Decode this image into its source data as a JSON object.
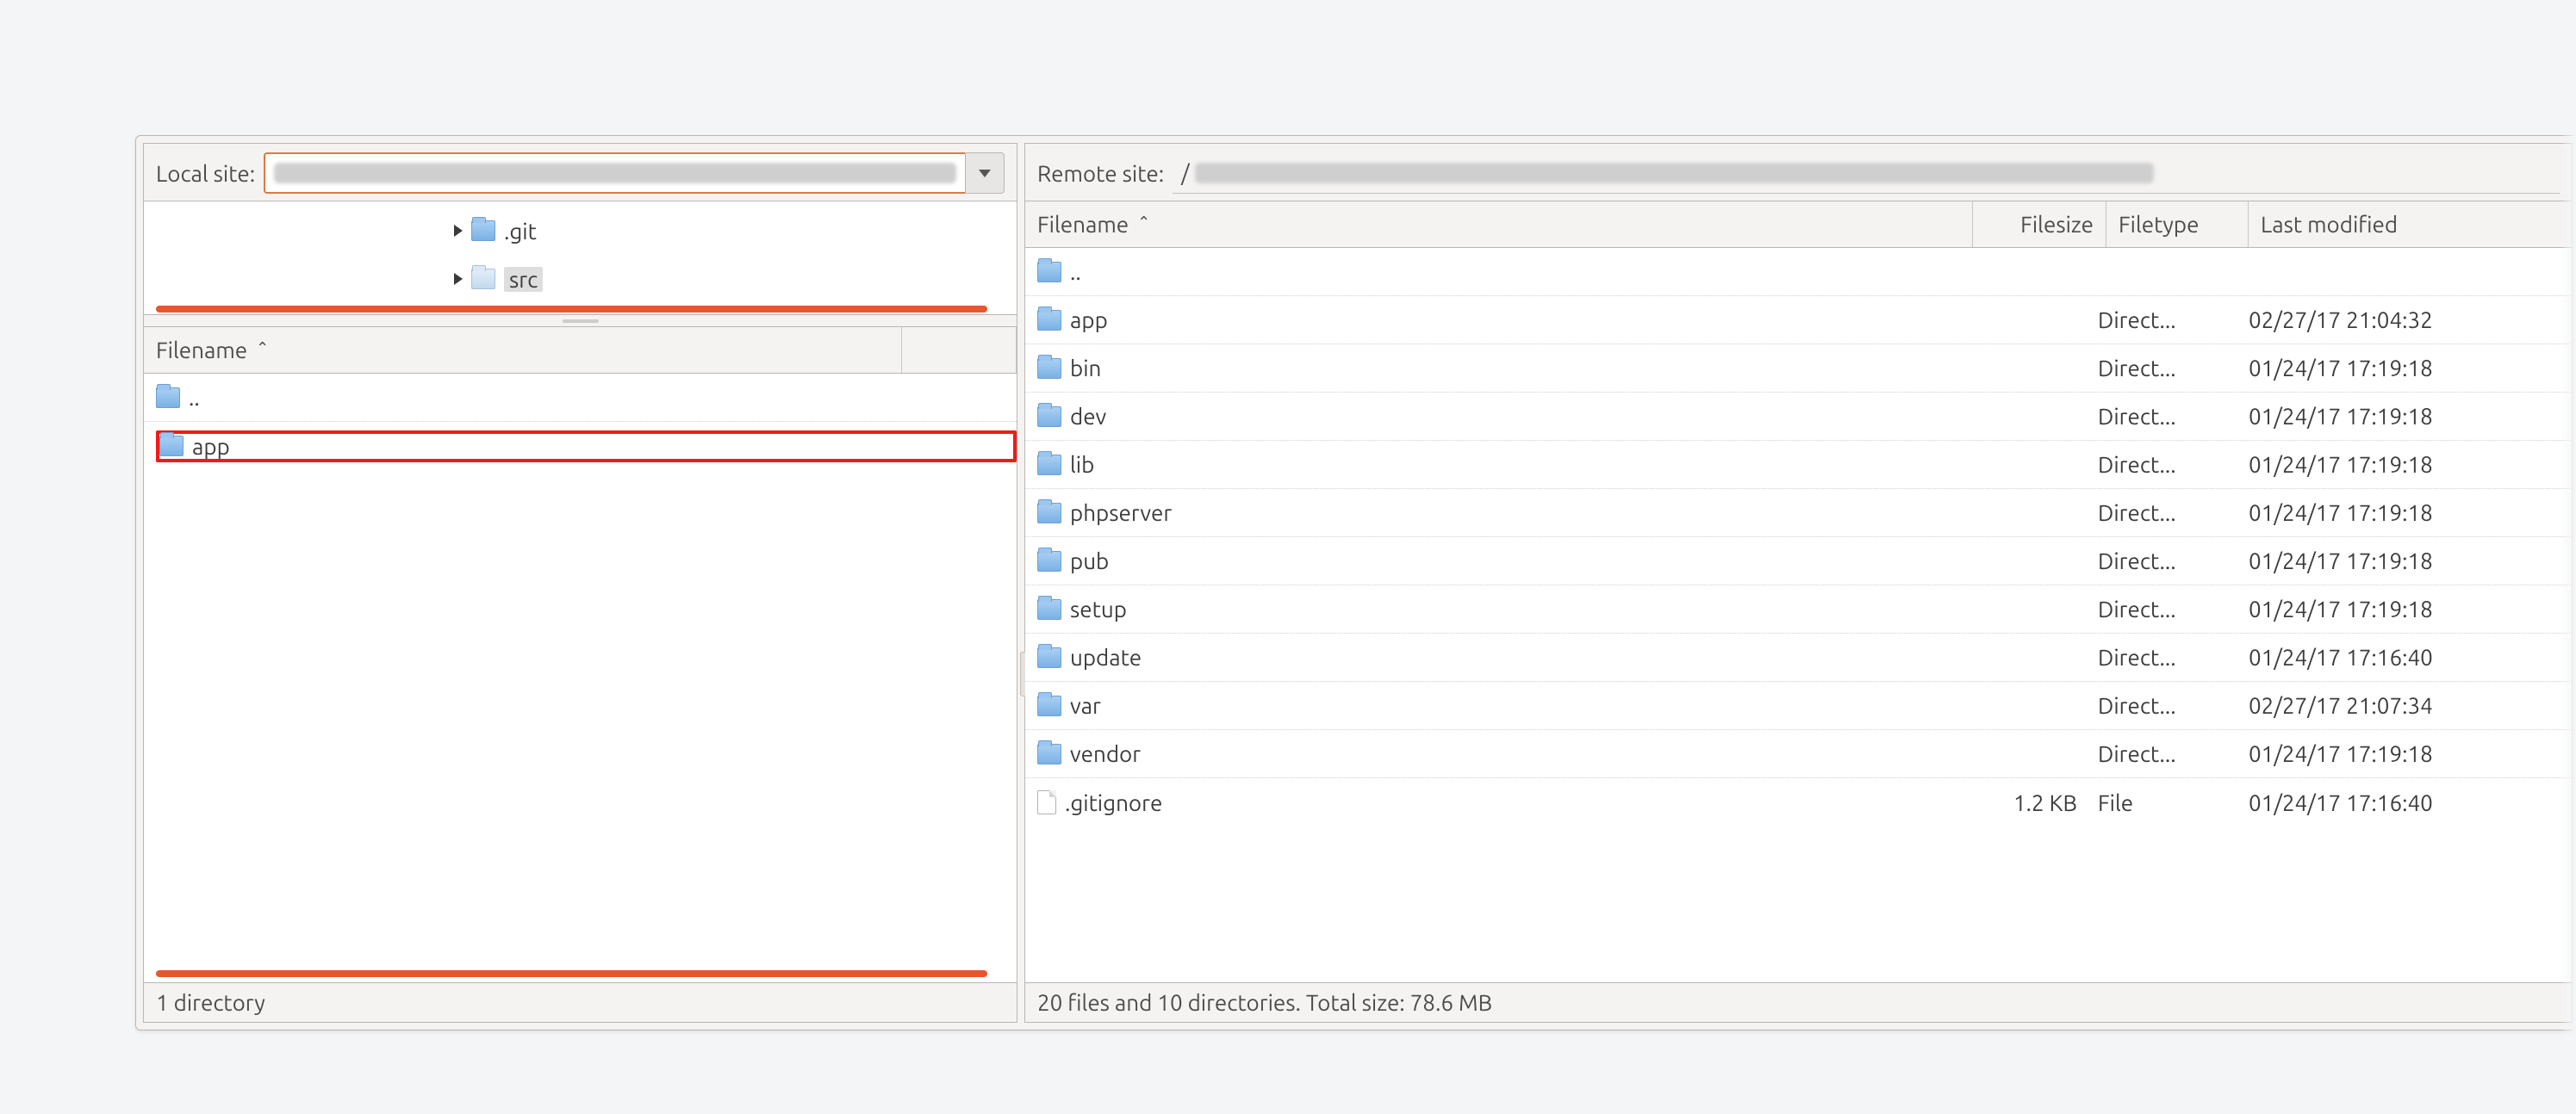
{
  "local": {
    "label": "Local site:",
    "tree": [
      {
        "name": ".git",
        "selected": false
      },
      {
        "name": "src",
        "selected": true
      }
    ],
    "columns": {
      "filename": "Filename"
    },
    "rows": [
      {
        "name": "..",
        "icon": "folder",
        "highlight": false,
        "parent": true
      },
      {
        "name": "app",
        "icon": "folder",
        "highlight": true,
        "parent": false
      }
    ],
    "status": "1 directory"
  },
  "remote": {
    "label": "Remote site:",
    "path_prefix": "/",
    "columns": {
      "filename": "Filename",
      "filesize": "Filesize",
      "filetype": "Filetype",
      "modified": "Last modified"
    },
    "rows": [
      {
        "name": "..",
        "icon": "folder",
        "size": "",
        "type": "",
        "mod": ""
      },
      {
        "name": "app",
        "icon": "folder",
        "size": "",
        "type": "Direct...",
        "mod": "02/27/17 21:04:32"
      },
      {
        "name": "bin",
        "icon": "folder",
        "size": "",
        "type": "Direct...",
        "mod": "01/24/17 17:19:18"
      },
      {
        "name": "dev",
        "icon": "folder",
        "size": "",
        "type": "Direct...",
        "mod": "01/24/17 17:19:18"
      },
      {
        "name": "lib",
        "icon": "folder",
        "size": "",
        "type": "Direct...",
        "mod": "01/24/17 17:19:18"
      },
      {
        "name": "phpserver",
        "icon": "folder",
        "size": "",
        "type": "Direct...",
        "mod": "01/24/17 17:19:18"
      },
      {
        "name": "pub",
        "icon": "folder",
        "size": "",
        "type": "Direct...",
        "mod": "01/24/17 17:19:18"
      },
      {
        "name": "setup",
        "icon": "folder",
        "size": "",
        "type": "Direct...",
        "mod": "01/24/17 17:19:18"
      },
      {
        "name": "update",
        "icon": "folder",
        "size": "",
        "type": "Direct...",
        "mod": "01/24/17 17:16:40"
      },
      {
        "name": "var",
        "icon": "folder",
        "size": "",
        "type": "Direct...",
        "mod": "02/27/17 21:07:34"
      },
      {
        "name": "vendor",
        "icon": "folder",
        "size": "",
        "type": "Direct...",
        "mod": "01/24/17 17:19:18"
      },
      {
        "name": ".gitignore",
        "icon": "file",
        "size": "1.2 KB",
        "type": "File",
        "mod": "01/24/17 17:16:40"
      }
    ],
    "status": "20 files and 10 directories. Total size: 78.6 MB"
  }
}
